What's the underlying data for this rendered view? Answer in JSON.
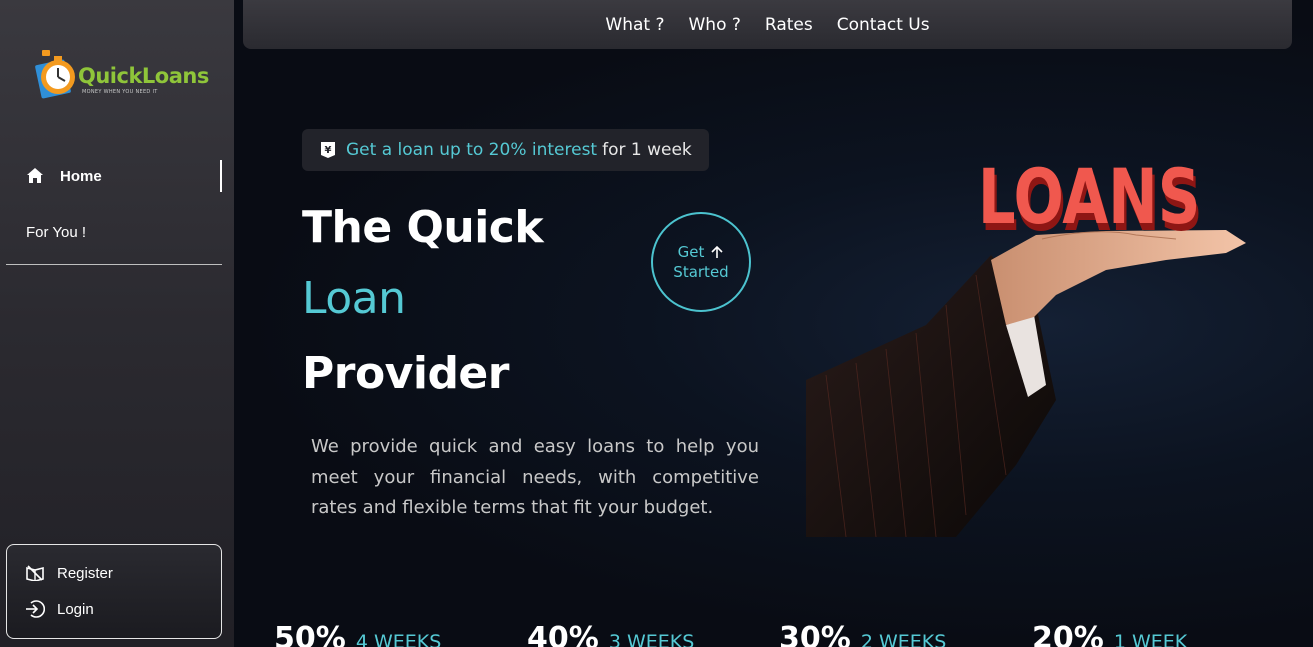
{
  "logo": {
    "word_part1": "Quick",
    "word_part2": "Loans",
    "tagline": "MONEY WHEN YOU NEED IT",
    "brand_orange": "#f39a1f",
    "brand_green": "#8fc53a",
    "brand_blue": "#2f8fd8"
  },
  "sidebar": {
    "items": [
      {
        "label": "Home",
        "icon": "home-icon",
        "active": true
      },
      {
        "label": "For You !"
      }
    ],
    "auth": [
      {
        "label": "Register",
        "icon": "register-icon"
      },
      {
        "label": "Login",
        "icon": "login-icon"
      }
    ]
  },
  "topnav": {
    "links": [
      "What ?",
      "Who ?",
      "Rates",
      "Contact Us"
    ]
  },
  "hero": {
    "promo_icon": "yen-tag-icon",
    "promo_accent": "Get a loan up to 20% interest",
    "promo_rest": "for 1 week",
    "title_line1": "The Quick",
    "title_line2": "Loan",
    "title_line3": "Provider",
    "cta_line1": "Get",
    "cta_line2": "Started",
    "cta_icon": "arrow-up-icon",
    "description": "We provide quick and easy loans to help you meet your financial needs, with competitive rates and flexible terms that fit your budget.",
    "image_text": "LOANS",
    "accent_color": "#55c9d4"
  },
  "rates": [
    {
      "percent": "50%",
      "duration": "4 WEEKS"
    },
    {
      "percent": "40%",
      "duration": "3 WEEKS"
    },
    {
      "percent": "30%",
      "duration": "2 WEEKS"
    },
    {
      "percent": "20%",
      "duration": "1 WEEK"
    }
  ]
}
